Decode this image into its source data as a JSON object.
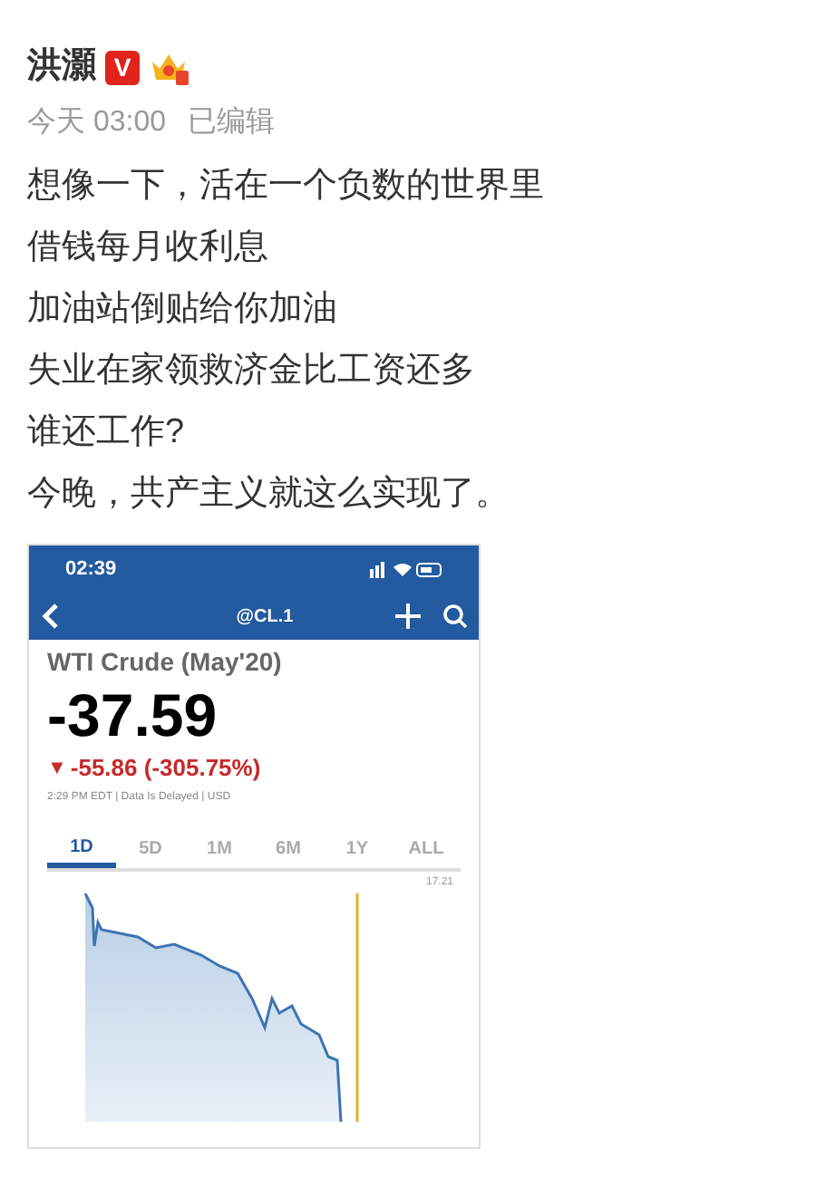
{
  "author": {
    "name": "洪灝",
    "badge": "V"
  },
  "meta": {
    "time": "今天 03:00",
    "edited": "已编辑"
  },
  "lines": [
    "想像一下，活在一个负数的世界里",
    "借钱每月收利息",
    "加油站倒贴给你加油",
    "失业在家领救济金比工资还多",
    "谁还工作?",
    "今晚，共产主义就这么实现了。"
  ],
  "embed": {
    "status_time": "02:39",
    "nav_title": "@CL.1",
    "instrument": "WTI Crude (May'20)",
    "price": "-37.59",
    "change_arrow": "▼",
    "change": "-55.86 (-305.75%)",
    "note": "2:29 PM EDT | Data Is Delayed | USD",
    "ranges": [
      {
        "label": "1D",
        "selected": true
      },
      {
        "label": "5D",
        "selected": false
      },
      {
        "label": "1M",
        "selected": false
      },
      {
        "label": "6M",
        "selected": false
      },
      {
        "label": "1Y",
        "selected": false
      },
      {
        "label": "ALL",
        "selected": false
      }
    ],
    "axis_label": "17.21"
  }
}
